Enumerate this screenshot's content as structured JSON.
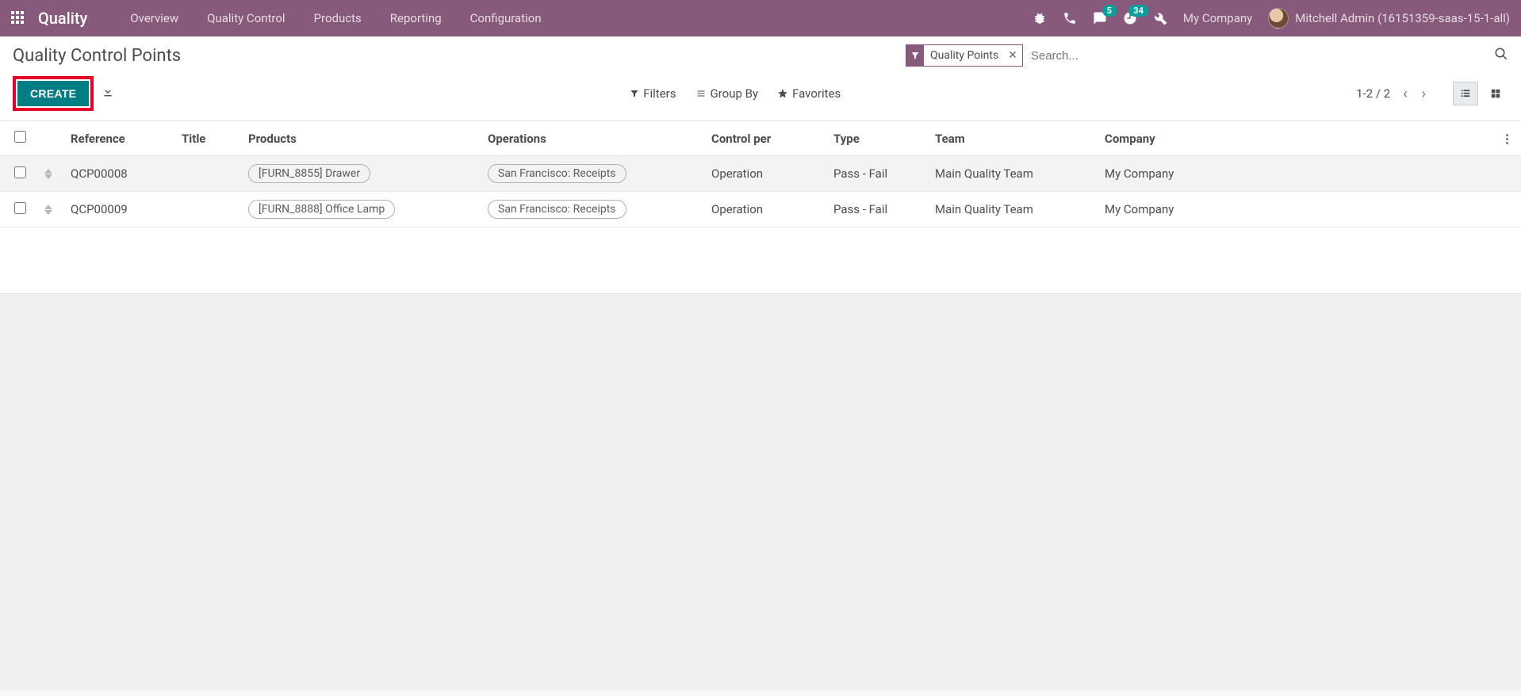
{
  "app_title": "Quality",
  "menu": [
    "Overview",
    "Quality Control",
    "Products",
    "Reporting",
    "Configuration"
  ],
  "tray": {
    "msg_count": "5",
    "activity_count": "34"
  },
  "company": "My Company",
  "user": "Mitchell Admin (16151359-saas-15-1-all)",
  "breadcrumb": "Quality Control Points",
  "search": {
    "facet_label": "Quality Points",
    "placeholder": "Search..."
  },
  "buttons": {
    "create": "CREATE"
  },
  "toolbar": {
    "filters": "Filters",
    "groupby": "Group By",
    "favorites": "Favorites"
  },
  "pager": {
    "range": "1-2 / 2"
  },
  "columns": {
    "reference": "Reference",
    "title": "Title",
    "products": "Products",
    "operations": "Operations",
    "control_per": "Control per",
    "type": "Type",
    "team": "Team",
    "company": "Company"
  },
  "rows": [
    {
      "reference": "QCP00008",
      "title": "",
      "product": "[FURN_8855] Drawer",
      "operation": "San Francisco: Receipts",
      "control_per": "Operation",
      "type": "Pass - Fail",
      "team": "Main Quality Team",
      "company": "My Company"
    },
    {
      "reference": "QCP00009",
      "title": "",
      "product": "[FURN_8888] Office Lamp",
      "operation": "San Francisco: Receipts",
      "control_per": "Operation",
      "type": "Pass - Fail",
      "team": "Main Quality Team",
      "company": "My Company"
    }
  ]
}
